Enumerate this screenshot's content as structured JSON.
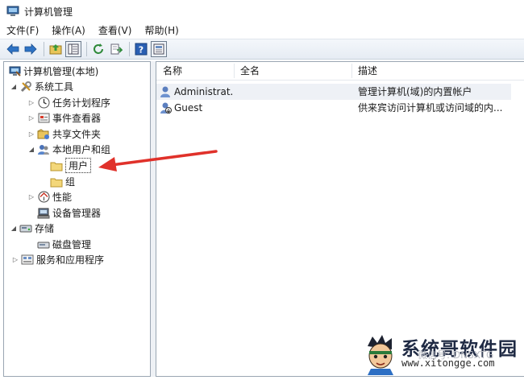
{
  "window": {
    "title": "计算机管理"
  },
  "menu": [
    "文件(F)",
    "操作(A)",
    "查看(V)",
    "帮助(H)"
  ],
  "toolbar": {
    "icons": [
      "back-arrow-icon",
      "forward-arrow-icon",
      "up-folder-icon",
      "show-hide-tree-icon",
      "refresh-icon",
      "export-icon",
      "help-icon",
      "properties-icon"
    ]
  },
  "tree": {
    "root": "计算机管理(本地)",
    "system_tools": "系统工具",
    "task_scheduler": "任务计划程序",
    "event_viewer": "事件查看器",
    "shared_folders": "共享文件夹",
    "local_users_groups": "本地用户和组",
    "users": "用户",
    "groups": "组",
    "performance": "性能",
    "device_manager": "设备管理器",
    "storage": "存储",
    "disk_management": "磁盘管理",
    "services_apps": "服务和应用程序"
  },
  "list": {
    "columns": [
      "名称",
      "全名",
      "描述"
    ],
    "rows": [
      {
        "name": "Administrat...",
        "fullname": "",
        "description": "管理计算机(域)的内置帐户"
      },
      {
        "name": "Guest",
        "fullname": "",
        "description": "供来宾访问计算机或访问域的内..."
      }
    ]
  },
  "watermark": {
    "brand": "系统哥软件园",
    "url": "www.xitongge.com",
    "overlay": "微信号: DNSXTG"
  },
  "colors": {
    "arrow": "#e0312a",
    "selection": "#eef1f6",
    "pane_border": "#9aa6b2"
  }
}
